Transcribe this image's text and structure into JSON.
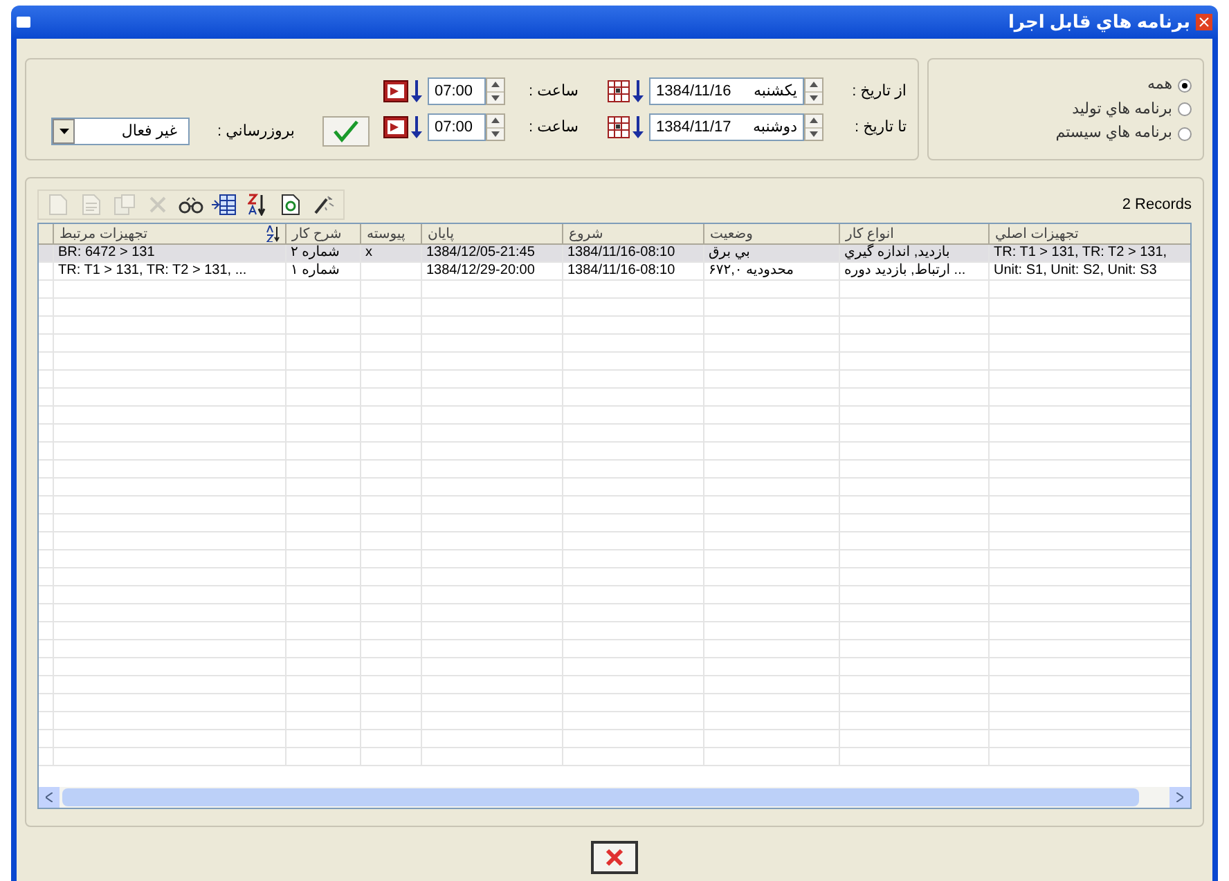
{
  "window": {
    "title": "برنامه هاي قابل اجرا"
  },
  "filters": {
    "from": {
      "label": "از تاريخ :",
      "day": "يكشنبه",
      "date": "1384/11/16",
      "time_label": "ساعت :",
      "time": "07:00"
    },
    "to": {
      "label": "تا تاريخ :",
      "day": "دوشنبه",
      "date": "1384/11/17",
      "time_label": "ساعت :",
      "time": "07:00"
    },
    "refresh": {
      "label": "بروزرساني :",
      "value": "غير فعال"
    }
  },
  "program_types": [
    {
      "label": "همه",
      "selected": true
    },
    {
      "label": "برنامه هاي توليد",
      "selected": false
    },
    {
      "label": "برنامه هاي سيستم",
      "selected": false
    }
  ],
  "toolbar": [
    {
      "disabled": true
    },
    {
      "disabled": true
    },
    {
      "disabled": true
    },
    {
      "disabled": true
    },
    {
      "disabled": false
    },
    {
      "disabled": false
    },
    {
      "disabled": false
    },
    {
      "disabled": false
    },
    {
      "disabled": false
    }
  ],
  "record_count": "2 Records",
  "table": {
    "columns": [
      "تجهيزات اصلي",
      "انواع كار",
      "وضعيت",
      "شروع",
      "پايان",
      "پيوسته",
      "شرح كار",
      "تجهيزات مرتبط"
    ],
    "rows": [
      {
        "selected": true,
        "cells": [
          "TR: T1 > 131, TR: T2 > 131,",
          "بازديد, اندازه گيري",
          "بي برق",
          "1384/11/16-08:10",
          "1384/12/05-21:45",
          "x",
          "شماره ۲",
          "BR: 6472 > 131"
        ]
      },
      {
        "selected": false,
        "cells": [
          "Unit: S1, Unit: S2, Unit: S3",
          "... ارتباط, بازديد دوره",
          "محدوديه ۶۷۲,۰",
          "1384/11/16-08:10",
          "1384/12/29-20:00",
          "",
          "شماره ۱",
          "TR: T1 > 131, TR: T2 > 131, ..."
        ]
      }
    ]
  }
}
